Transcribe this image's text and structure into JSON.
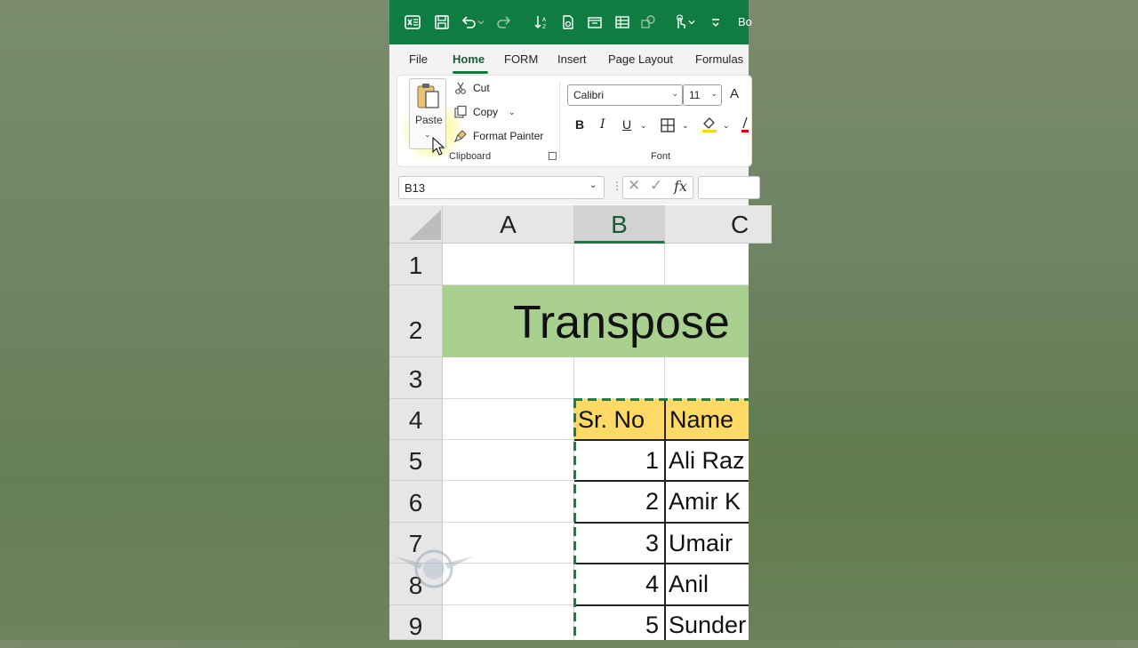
{
  "titlebar": {
    "title": "Bo"
  },
  "tabs": [
    {
      "label": "File"
    },
    {
      "label": "Home"
    },
    {
      "label": "FORM"
    },
    {
      "label": "Insert"
    },
    {
      "label": "Page Layout"
    },
    {
      "label": "Formulas"
    }
  ],
  "clipboard": {
    "paste_label": "Paste",
    "cut_label": "Cut",
    "copy_label": "Copy",
    "format_painter_label": "Format Painter",
    "group_label": "Clipboard"
  },
  "font": {
    "family": "Calibri",
    "size": "11",
    "bold": "B",
    "italic": "I",
    "underline": "U",
    "group_label": "Font"
  },
  "formula_bar": {
    "name_box": "B13",
    "fx_label": "fx"
  },
  "columns": [
    "A",
    "B",
    "C"
  ],
  "rows": [
    "1",
    "2",
    "3",
    "4",
    "5",
    "6",
    "7",
    "8",
    "9"
  ],
  "sheet": {
    "title": "Transpose",
    "header_sr": "Sr. No",
    "header_name": "Name",
    "records": [
      {
        "sr": "1",
        "name": "Ali Raz"
      },
      {
        "sr": "2",
        "name": "Amir K"
      },
      {
        "sr": "3",
        "name": "Umair"
      },
      {
        "sr": "4",
        "name": "Anil"
      },
      {
        "sr": "5",
        "name": "Sunder"
      }
    ]
  },
  "colors": {
    "brand_green": "#107c41",
    "title_band": "#a9d08e",
    "header_fill": "#ffd966"
  }
}
